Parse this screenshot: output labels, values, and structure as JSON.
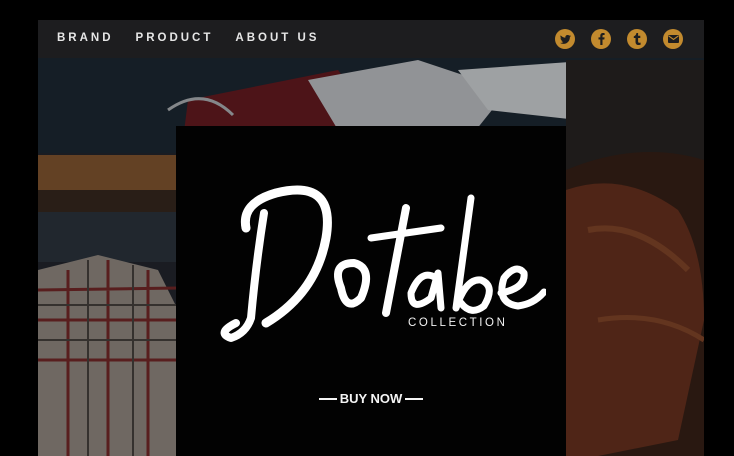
{
  "nav": {
    "items": [
      "BRAND",
      "PRODUCT",
      "ABOUT US"
    ]
  },
  "social": [
    {
      "icon": "twitter-icon",
      "glyph": "bird"
    },
    {
      "icon": "facebook-icon",
      "glyph": "f"
    },
    {
      "icon": "tumblr-icon",
      "glyph": "t"
    },
    {
      "icon": "mail-icon",
      "glyph": "envelope"
    }
  ],
  "hero": {
    "logo_text": "Dotabe",
    "subtitle": "COLLECTION",
    "cta_label": "BUY NOW"
  },
  "colors": {
    "accent": "#c28a2e",
    "topbar": "#1d1d1f",
    "hero_bg": "#020202",
    "text": "#f2f2f2"
  }
}
